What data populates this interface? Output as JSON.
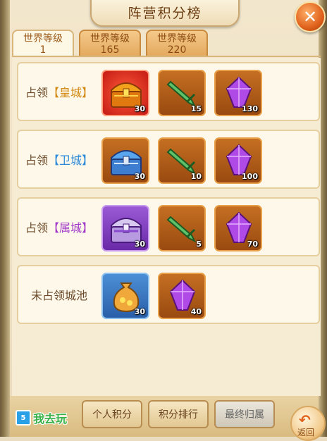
{
  "title": "阵营积分榜",
  "tabs": [
    {
      "label": "世界等级",
      "level": "1"
    },
    {
      "label": "世界等级",
      "level": "165"
    },
    {
      "label": "世界等级",
      "level": "220"
    }
  ],
  "rows": [
    {
      "prefix": "占领",
      "bracket_open": "【",
      "city": "皇城",
      "bracket_close": "】",
      "rewards": [
        {
          "icon": "red-treasure-chest-icon",
          "qty": "30"
        },
        {
          "icon": "green-sword-icon",
          "qty": "15"
        },
        {
          "icon": "purple-crystal-icon",
          "qty": "130"
        }
      ]
    },
    {
      "prefix": "占领",
      "bracket_open": "【",
      "city": "卫城",
      "bracket_close": "】",
      "rewards": [
        {
          "icon": "blue-treasure-chest-icon",
          "qty": "30"
        },
        {
          "icon": "green-sword-icon",
          "qty": "10"
        },
        {
          "icon": "purple-crystal-icon",
          "qty": "100"
        }
      ]
    },
    {
      "prefix": "占领",
      "bracket_open": "【",
      "city": "属城",
      "bracket_close": "】",
      "rewards": [
        {
          "icon": "purple-treasure-chest-icon",
          "qty": "30"
        },
        {
          "icon": "green-sword-icon",
          "qty": "5"
        },
        {
          "icon": "purple-crystal-icon",
          "qty": "70"
        }
      ]
    },
    {
      "label": "未占领城池",
      "rewards": [
        {
          "icon": "gold-coin-bag-icon",
          "qty": "30"
        },
        {
          "icon": "purple-crystal-icon",
          "qty": "40"
        }
      ]
    }
  ],
  "bottom": {
    "logo_text": "我去玩",
    "logo_badge": "5",
    "personal_label": "个人积分",
    "ranking_label": "积分排行",
    "final_label": "最终归属",
    "back_label": "返回"
  },
  "colors": {
    "gold": "#d28a14",
    "blue": "#2d8ad8",
    "purple": "#a03ac8"
  }
}
